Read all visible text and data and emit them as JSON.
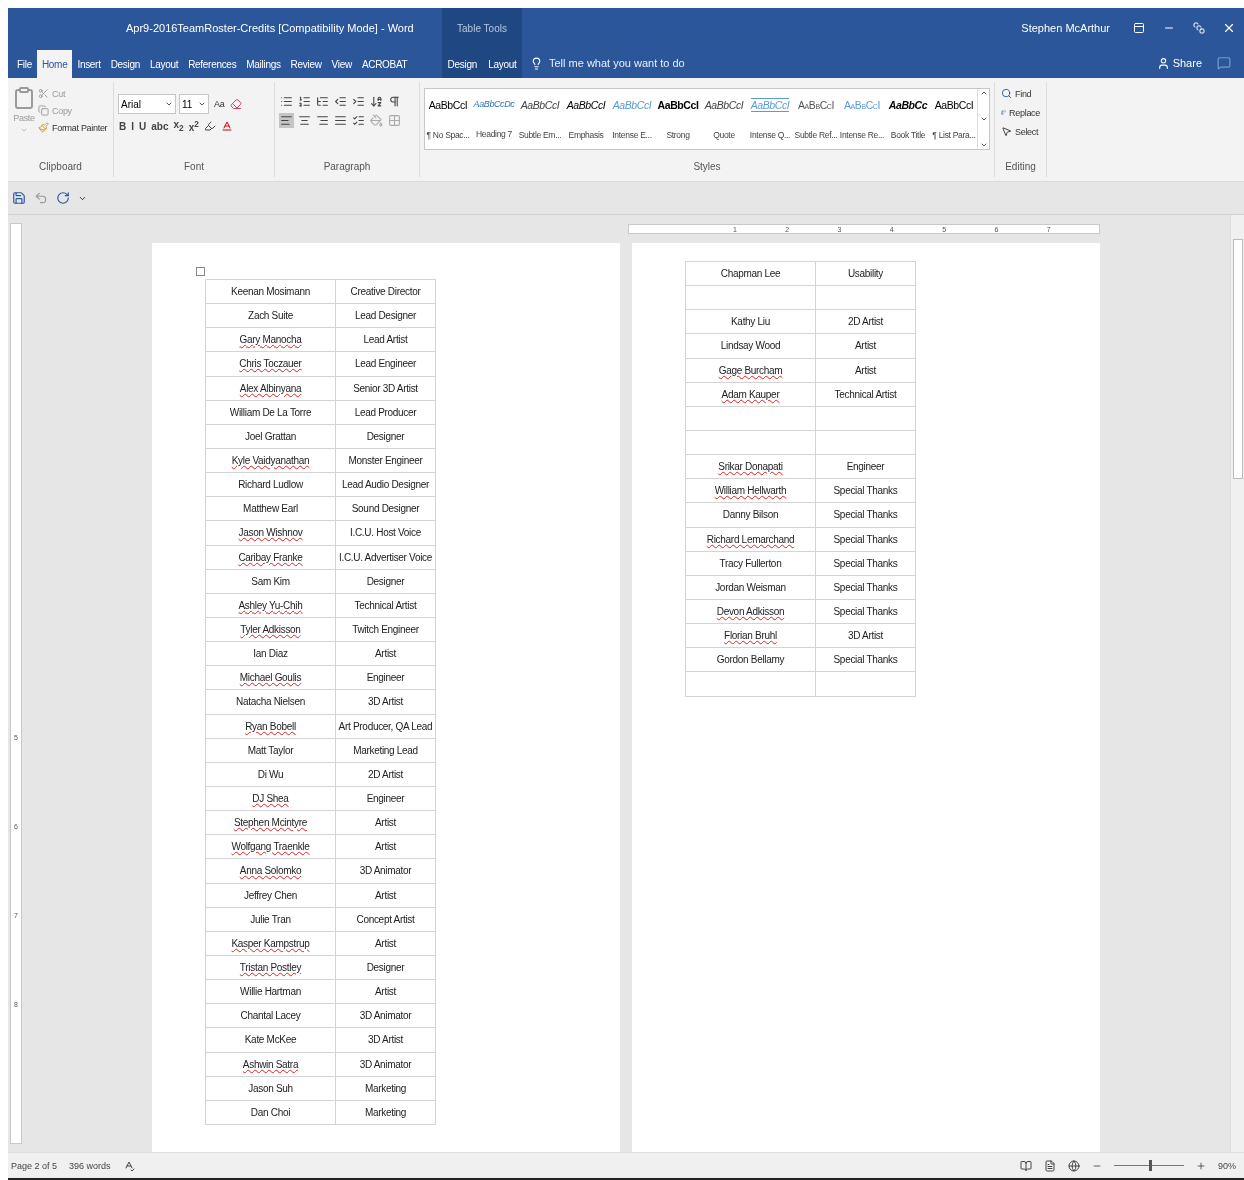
{
  "window": {
    "title": "Apr9-2016TeamRoster-Credits [Compatibility Mode] - Word",
    "context_label": "Table Tools",
    "user": "Stephen McArthur"
  },
  "tabs": [
    {
      "label": "File",
      "selected": false,
      "contextual": false
    },
    {
      "label": "Home",
      "selected": true,
      "contextual": false
    },
    {
      "label": "Insert",
      "selected": false,
      "contextual": false
    },
    {
      "label": "Design",
      "selected": false,
      "contextual": false
    },
    {
      "label": "Layout",
      "selected": false,
      "contextual": false
    },
    {
      "label": "References",
      "selected": false,
      "contextual": false
    },
    {
      "label": "Mailings",
      "selected": false,
      "contextual": false
    },
    {
      "label": "Review",
      "selected": false,
      "contextual": false
    },
    {
      "label": "View",
      "selected": false,
      "contextual": false
    },
    {
      "label": "ACROBAT",
      "selected": false,
      "contextual": false
    },
    {
      "label": "Design",
      "selected": false,
      "contextual": true
    },
    {
      "label": "Layout",
      "selected": false,
      "contextual": true
    }
  ],
  "search": {
    "placeholder": "Tell me what you want to do"
  },
  "share": "Share",
  "clipboard": {
    "paste": "Paste",
    "cut": "Cut",
    "copy": "Copy",
    "format_painter": "Format Painter",
    "label": "Clipboard"
  },
  "font": {
    "name": "Arial",
    "size": "11",
    "change_case": "Aa",
    "buttons": [
      "B",
      "I",
      "U",
      "abc",
      "x$_{2}$",
      "x$^{2}$"
    ],
    "label": "Font"
  },
  "paragraph": {
    "label": "Paragraph",
    "alignments": [
      {
        "selected": true
      },
      {
        "selected": false
      },
      {
        "selected": false
      },
      {
        "selected": false
      }
    ]
  },
  "styles": {
    "label": "Styles",
    "items": [
      {
        "preview": "AaBbCcI",
        "label": "¶ No Spac...",
        "kind": "normal"
      },
      {
        "preview": "AaBbCcDc",
        "label": "Heading 7",
        "kind": "heading"
      },
      {
        "preview": "AaBbCcI",
        "label": "Subtle Em...",
        "kind": "italic-grey"
      },
      {
        "preview": "AaBbCcI",
        "label": "Emphasis",
        "kind": "italic"
      },
      {
        "preview": "AaBbCcI",
        "label": "Intense E...",
        "kind": "italic-blue"
      },
      {
        "preview": "AaBbCcI",
        "label": "Strong",
        "kind": "bold"
      },
      {
        "preview": "AaBbCcI",
        "label": "Quote",
        "kind": "italic-grey"
      },
      {
        "preview": "AaBbCcI",
        "label": "Intense Q...",
        "kind": "intense-quote"
      },
      {
        "preview": "AaBbCcI",
        "label": "Subtle Ref...",
        "kind": "smallcaps-grey"
      },
      {
        "preview": "AaBbCcI",
        "label": "Intense Re...",
        "kind": "smallcaps-blue"
      },
      {
        "preview": "AaBbCc",
        "label": "Book Title",
        "kind": "bold-italic"
      },
      {
        "preview": "AaBbCcI",
        "label": "¶ List Para...",
        "kind": "normal"
      }
    ]
  },
  "editing": {
    "find": "Find",
    "replace": "Replace",
    "select": "Select",
    "label": "Editing"
  },
  "rulers": {
    "horizontal": [
      "1",
      "2",
      "3",
      "4",
      "5",
      "6",
      "7"
    ],
    "vertical": [
      "5",
      "6",
      "7",
      "8"
    ]
  },
  "pages": [
    {
      "rows": [
        {
          "name": "Keenan Mosimann",
          "role": "Creative Director",
          "flagged": false
        },
        {
          "name": "Zach Suite",
          "role": "Lead Designer",
          "flagged": false
        },
        {
          "name": "Gary Manocha",
          "role": "Lead Artist",
          "flagged": true
        },
        {
          "name": "Chris Toczauer",
          "role": "Lead Engineer",
          "flagged": true
        },
        {
          "name": "Alex Albinyana",
          "role": "Senior 3D Artist",
          "flagged": true
        },
        {
          "name": "William De La Torre",
          "role": "Lead Producer",
          "flagged": false
        },
        {
          "name": "Joel Grattan",
          "role": "Designer",
          "flagged": false
        },
        {
          "name": "Kyle Vaidyanathan",
          "role": "Monster Engineer",
          "flagged": true
        },
        {
          "name": "Richard Ludlow",
          "role": "Lead Audio Designer",
          "flagged": false
        },
        {
          "name": "Matthew Earl",
          "role": "Sound Designer",
          "flagged": false
        },
        {
          "name": "Jason Wishnov",
          "role": "I.C.U. Host Voice",
          "flagged": true
        },
        {
          "name": "Caribay Franke",
          "role": "I.C.U. Advertiser Voice",
          "flagged": true
        },
        {
          "name": "Sam Kim",
          "role": "Designer",
          "flagged": false
        },
        {
          "name": "Ashley Yu-Chih",
          "role": "Technical Artist",
          "flagged": true
        },
        {
          "name": "Tyler Adkisson",
          "role": "Twitch Engineer",
          "flagged": true
        },
        {
          "name": "Ian Diaz",
          "role": "Artist",
          "flagged": false
        },
        {
          "name": "Michael Goulis",
          "role": "Engineer",
          "flagged": true
        },
        {
          "name": "Natacha Nielsen",
          "role": "3D Artist",
          "flagged": false
        },
        {
          "name": "Ryan Bobell",
          "role": "Art Producer, QA Lead",
          "flagged": true
        },
        {
          "name": "Matt Taylor",
          "role": "Marketing Lead",
          "flagged": false
        },
        {
          "name": "Di Wu",
          "role": "2D Artist",
          "flagged": false
        },
        {
          "name": "DJ Shea",
          "role": "Engineer",
          "flagged": true
        },
        {
          "name": "Stephen Mcintyre",
          "role": "Artist",
          "flagged": true
        },
        {
          "name": "Wolfgang Traenkle",
          "role": "Artist",
          "flagged": true
        },
        {
          "name": "Anna Solomko",
          "role": "3D Animator",
          "flagged": true
        },
        {
          "name": "Jeffrey Chen",
          "role": "Artist",
          "flagged": false
        },
        {
          "name": "Julie Tran",
          "role": "Concept Artist",
          "flagged": false
        },
        {
          "name": "Kasper Kampstrup",
          "role": "Artist",
          "flagged": true
        },
        {
          "name": "Tristan Postley",
          "role": "Designer",
          "flagged": true
        },
        {
          "name": "Willie Hartman",
          "role": "Artist",
          "flagged": false
        },
        {
          "name": "Chantal Lacey",
          "role": "3D Animator",
          "flagged": false
        },
        {
          "name": "Kate McKee",
          "role": "3D Artist",
          "flagged": false
        },
        {
          "name": "Ashwin Satra",
          "role": "3D Animator",
          "flagged": true
        },
        {
          "name": "Jason Suh",
          "role": "Marketing",
          "flagged": false
        },
        {
          "name": "Dan Choi",
          "role": "Marketing",
          "flagged": false
        }
      ]
    },
    {
      "rows": [
        {
          "name": "Chapman Lee",
          "role": "Usability",
          "flagged": false
        },
        {},
        {
          "name": "Kathy Liu",
          "role": "2D Artist",
          "flagged": false
        },
        {
          "name": "Lindsay Wood",
          "role": "Artist",
          "flagged": false
        },
        {
          "name": "Gage Burcham",
          "role": "Artist",
          "flagged": true
        },
        {
          "name": "Adam Kauper",
          "role": "Technical Artist",
          "flagged": true
        },
        {},
        {},
        {
          "name": "Srikar Donapati",
          "role": "Engineer",
          "flagged": true
        },
        {
          "name": "William Hellwarth",
          "role": "Special Thanks",
          "flagged": true
        },
        {
          "name": "Danny Bilson",
          "role": "Special Thanks",
          "flagged": false
        },
        {
          "name": "Richard Lemarchand",
          "role": "Special Thanks",
          "flagged": true
        },
        {
          "name": "Tracy Fullerton",
          "role": "Special Thanks",
          "flagged": false
        },
        {
          "name": "Jordan Weisman",
          "role": "Special Thanks",
          "flagged": false
        },
        {
          "name": "Devon Adkisson",
          "role": "Special Thanks",
          "flagged": true
        },
        {
          "name": "Florian Bruhl",
          "role": "3D Artist",
          "flagged": true
        },
        {
          "name": "Gordon Bellamy",
          "role": "Special Thanks",
          "flagged": false
        },
        {}
      ]
    }
  ],
  "status": {
    "page": "Page 2 of 5",
    "words": "396 words",
    "zoom": "90%",
    "zoom_slider": {
      "level": 0.5
    }
  }
}
